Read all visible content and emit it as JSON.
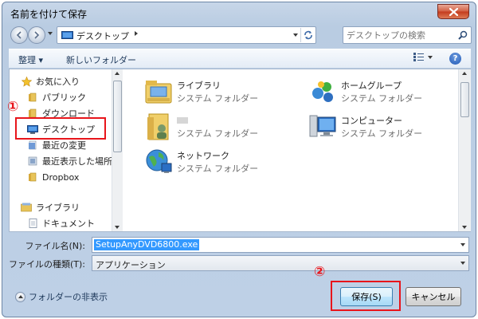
{
  "window": {
    "title": "名前を付けて保存",
    "close_icon": "close-icon"
  },
  "address": {
    "location": "デスクトップ",
    "search_placeholder": "デスクトップの検索"
  },
  "toolbar": {
    "organize": "整理 ▾",
    "new_folder": "新しいフォルダー"
  },
  "nav": {
    "favorites": [
      {
        "label": "お気に入り",
        "icon": "star-icon"
      },
      {
        "label": "パブリック",
        "icon": "folder-icon"
      },
      {
        "label": "ダウンロード",
        "icon": "folder-icon"
      },
      {
        "label": "デスクトップ",
        "icon": "desktop-icon"
      },
      {
        "label": "最近の変更",
        "icon": "recent-icon"
      },
      {
        "label": "最近表示した場所",
        "icon": "places-icon"
      },
      {
        "label": "Dropbox",
        "icon": "folder-icon"
      }
    ],
    "libraries": [
      {
        "label": "ライブラリ",
        "icon": "library-icon"
      },
      {
        "label": "ドキュメント",
        "icon": "document-icon"
      }
    ]
  },
  "content": {
    "items": [
      {
        "name": "ライブラリ",
        "type": "システム フォルダー",
        "icon": "library-folder-icon"
      },
      {
        "name": "ホームグループ",
        "type": "システム フォルダー",
        "icon": "homegroup-icon"
      },
      {
        "name": "",
        "type": "システム フォルダー",
        "icon": "user-folder-icon"
      },
      {
        "name": "コンピューター",
        "type": "システム フォルダー",
        "icon": "computer-icon"
      },
      {
        "name": "ネットワーク",
        "type": "システム フォルダー",
        "icon": "network-icon"
      }
    ]
  },
  "form": {
    "filename_label": "ファイル名(N):",
    "filename_value": "SetupAnyDVD6800.exe",
    "filetype_label": "ファイルの種類(T):",
    "filetype_value": "アプリケーション"
  },
  "footer": {
    "hide_folders": "フォルダーの非表示",
    "save": "保存(S)",
    "cancel": "キャンセル"
  },
  "annotations": {
    "marker1": "①",
    "marker2": "②",
    "color": "#e8151b"
  }
}
